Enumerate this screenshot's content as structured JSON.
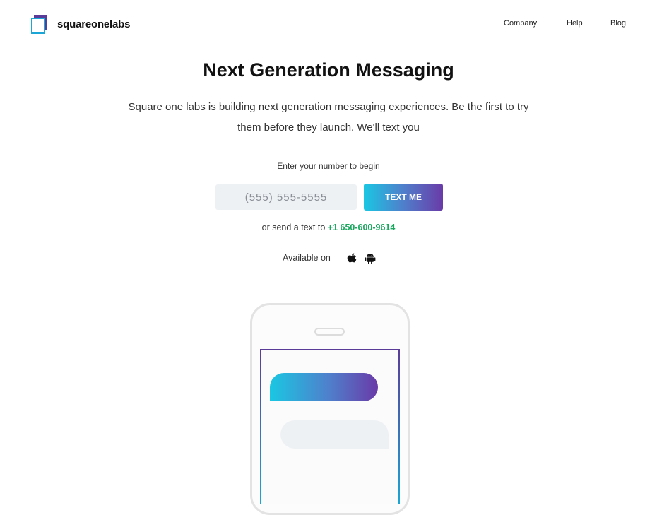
{
  "header": {
    "logo_text": "squareonelabs",
    "nav": [
      {
        "label": "Company"
      },
      {
        "label": "Help"
      },
      {
        "label": "Blog"
      }
    ]
  },
  "hero": {
    "headline": "Next Generation Messaging",
    "subhead": "Square one labs is building next generation messaging experiences. Be the first to try them before they launch. We'll text you",
    "prompt": "Enter your number to begin",
    "phone_placeholder": "(555) 555-5555",
    "phone_value": "",
    "cta_label": "TEXT ME",
    "alt_prefix": "or send a text to",
    "alt_number": "+1 650-600-9614",
    "available_label": "Available on",
    "platform_icons": [
      "apple-icon",
      "android-icon"
    ]
  },
  "colors": {
    "accent_start": "#1ac7e3",
    "accent_end": "#6a3ba8",
    "number_green": "#19a85e",
    "input_bg": "#eef1f4"
  }
}
